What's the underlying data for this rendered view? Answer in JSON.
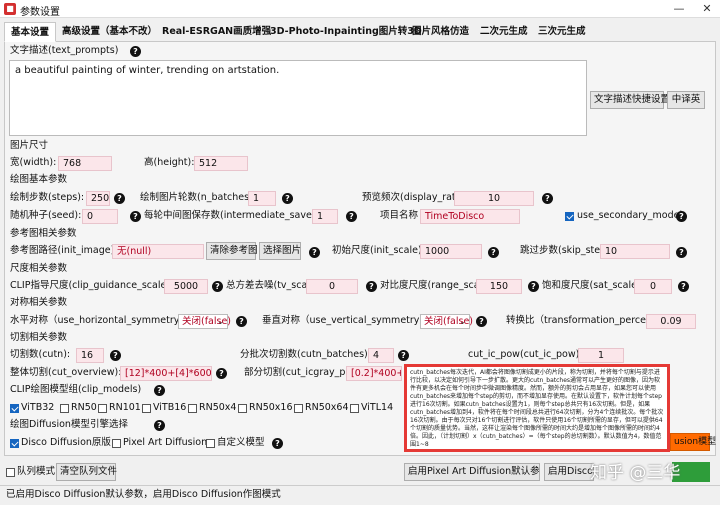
{
  "window": {
    "title": "参数设置",
    "minimize": "—",
    "close": "✕"
  },
  "tabs": [
    "基本设置",
    "高级设置（基本不改）",
    "Real-ESRGAN画质增强",
    "3D-Photo-Inpainting图片转3D",
    "图片风格仿造",
    "二次元生成",
    "三次元生成"
  ],
  "prompt": {
    "label": "文字描述(text_prompts)",
    "value": "a beautiful painting of winter, trending on artstation.",
    "shortcut_button": "文字描述快捷设置",
    "translate_button": "中译英"
  },
  "image_size": {
    "section": "图片尺寸",
    "width_label": "宽(width):",
    "width": "768",
    "height_label": "高(height):",
    "height": "512"
  },
  "basic": {
    "section": "绘图基本参数",
    "steps_label": "绘制步数(steps):",
    "steps": "250",
    "n_batches_label": "绘制图片轮数(n_batches):",
    "n_batches": "1",
    "display_rate_label": "预览频次(display_rate):",
    "display_rate": "10",
    "seed_label": "随机种子(seed):",
    "seed": "0",
    "intermediate_label": "每轮中间图保存数(intermediate_saves):",
    "intermediate": "1",
    "project_label": "项目名称",
    "project": "TimeToDisco",
    "secondary_label": "use_secondary_model"
  },
  "ref": {
    "section": "参考图相关参数",
    "init_image_label": "参考图路径(init_image):",
    "init_image": "无(null)",
    "clear_button": "清除参考图",
    "choose_button": "选择图片",
    "init_scale_label": "初始尺度(init_scale):",
    "init_scale": "1000",
    "skip_steps_label": "跳过步数(skip_steps):",
    "skip_steps": "10"
  },
  "scale": {
    "section": "尺度相关参数",
    "clip_label": "CLIP指导尺度(clip_guidance_scale):",
    "clip": "5000",
    "tv_label": "总方差去噪(tv_scale):",
    "tv": "0",
    "range_label": "对比度尺度(range_scale):",
    "range": "150",
    "sat_label": "饱和度尺度(sat_scale):",
    "sat": "0"
  },
  "sym": {
    "section": "对称相关参数",
    "h_label": "水平对称（use_horizontal_symmetry）",
    "h_value": "关闭(false)",
    "v_label": "垂直对称（use_vertical_symmetry）",
    "v_value": "关闭(false)",
    "trans_label": "转换比（transformation_percent）",
    "trans": "0.09"
  },
  "cut": {
    "section": "切割相关参数",
    "cutn_label": "切割数(cutn):",
    "cutn": "16",
    "cutn_batches_label": "分批次切割数(cutn_batches):",
    "cutn_batches": "4",
    "cut_ic_pow_label": "cut_ic_pow(cut_ic_pow):",
    "cut_ic_pow": "1",
    "overview_label": "整体切割(cut_overview):",
    "overview": "[12]*400+[4]*600",
    "icgray_label": "部分切割(cut_icgray_p):",
    "icgray": "[0.2]*400+"
  },
  "clip_models": {
    "section": "CLIP绘图模型组(clip_models)",
    "items": [
      {
        "label": "ViTB32",
        "checked": true
      },
      {
        "label": "RN50",
        "checked": false
      },
      {
        "label": "RN101",
        "checked": false
      },
      {
        "label": "ViTB16",
        "checked": false
      },
      {
        "label": "RN50x4",
        "checked": false
      },
      {
        "label": "RN50x16",
        "checked": false
      },
      {
        "label": "RN50x64",
        "checked": false
      },
      {
        "label": "ViTL14",
        "checked": false
      }
    ]
  },
  "diffusion": {
    "section": "绘图Diffusion模型引擎选择",
    "options": [
      "Disco Diffusion原版",
      "Pixel Art Diffusion",
      "自定义模型"
    ],
    "side_button": "usion模型"
  },
  "bottom": {
    "queue_label": "队列模式",
    "clear_queue": "清空队列文件",
    "btn_partial_1": "启用Pixel Art Diffusion默认参数",
    "btn_partial_2": "启用Disco"
  },
  "tooltip": "cutn_batches每次迭代，AI都会将图像切割成更小的片段，称为切割，并将每个切割与提示进行比较，以决定如何引导下一步扩散。更大的cutn_batches通常可以产生更好的图像，因为软件有更多机会在每个时间步中微调图像精度。然而，额外的剪切会占用显存，如果您可以使用cutn_batches来增加每个step的剪切，而不增加显存使用。在默认设置下，软件计划每个step进行16次切割。如果cutn_batches设置为1，则每个step总共只有16次切割。但是，如果cutn_batches增加到4，软件将在每个时间段总共进行64次切割，分为4个连续批次。每个批次16次切割。由于每次只对16个切割进行评估，软件只使用16个切割所需的显存，但可以提供64个切割的质量优势。当然，这样让渲染每个图像所需的时间大约是增加每个图像所需的时间约4倍。因此，（计划切割）x（cutn_batches）=（每个step的总切割数）。默认数值为4，数值范围1~8",
  "status": "已启用Disco Diffusion默认参数，启用Disco Diffusion作图模式",
  "watermark": "知乎 @三华"
}
